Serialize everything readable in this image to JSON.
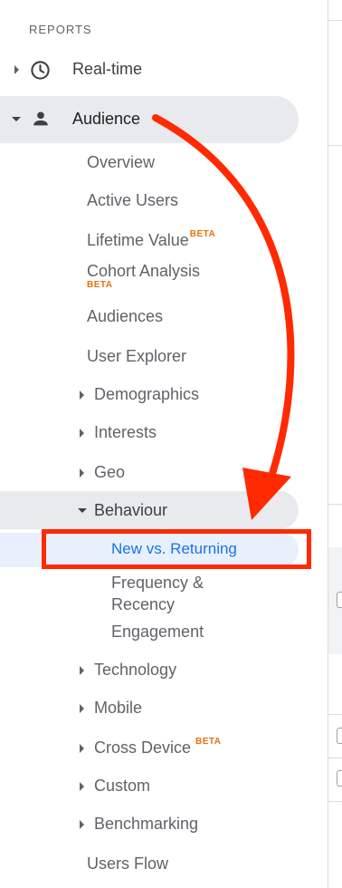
{
  "reports_header": "REPORTS",
  "nav": {
    "realtime_label": "Real-time",
    "audience_label": "Audience",
    "audience_children": {
      "overview": "Overview",
      "active_users": "Active Users",
      "lifetime_value": "Lifetime Value",
      "lifetime_value_badge": "BETA",
      "cohort_analysis": "Cohort Analysis",
      "cohort_analysis_badge": "BETA",
      "audiences": "Audiences",
      "user_explorer": "User Explorer",
      "demographics": "Demographics",
      "interests": "Interests",
      "geo": "Geo",
      "behaviour": "Behaviour",
      "behaviour_children": {
        "new_vs_returning": "New vs. Returning",
        "frequency_line1": "Frequency &",
        "frequency_line2": "Recency",
        "engagement": "Engagement"
      },
      "technology": "Technology",
      "mobile": "Mobile",
      "cross_device": "Cross Device",
      "cross_device_badge": "BETA",
      "custom": "Custom",
      "benchmarking": "Benchmarking",
      "users_flow": "Users Flow"
    }
  },
  "colors": {
    "annotation_red": "#ff2a00",
    "selected_text": "#1a73e8",
    "beta_orange": "#e8710a",
    "selected_bg": "#e8f0fe",
    "active_bg": "#e8eaed"
  },
  "icons": {
    "realtime": "clock-icon",
    "audience": "person-icon"
  }
}
